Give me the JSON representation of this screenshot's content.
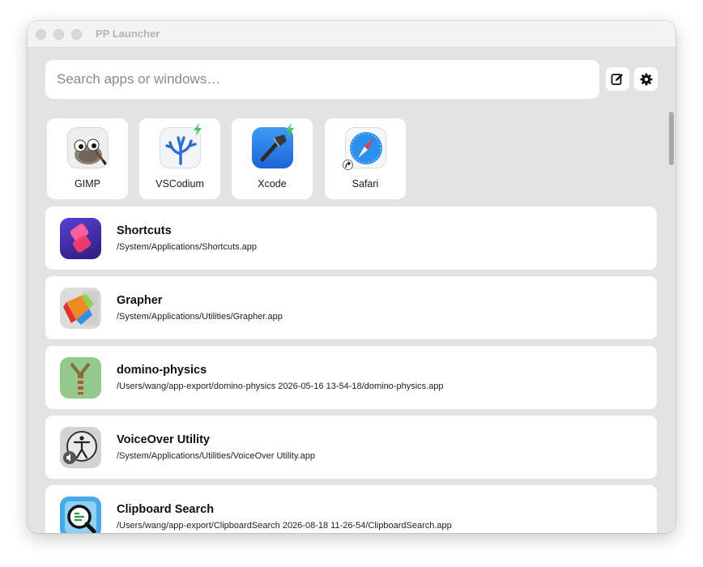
{
  "window": {
    "title": "PP Launcher"
  },
  "search": {
    "placeholder": "Search apps or windows…",
    "value": ""
  },
  "toolbar": {
    "edit_icon": "edit-icon",
    "settings_icon": "gear-icon"
  },
  "tiles": [
    {
      "label": "GIMP",
      "icon": "gimp-icon",
      "badge": ""
    },
    {
      "label": "VSCodium",
      "icon": "vscodium-icon",
      "badge": "running"
    },
    {
      "label": "Xcode",
      "icon": "xcode-icon",
      "badge": "running"
    },
    {
      "label": "Safari",
      "icon": "safari-icon",
      "badge": "alias"
    }
  ],
  "results": [
    {
      "name": "Shortcuts",
      "path": "/System/Applications/Shortcuts.app",
      "icon": "shortcuts-icon"
    },
    {
      "name": "Grapher",
      "path": "/System/Applications/Utilities/Grapher.app",
      "icon": "grapher-icon"
    },
    {
      "name": "domino-physics",
      "path": "/Users/wang/app-export/domino-physics 2026-05-16 13-54-18/domino-physics.app",
      "icon": "domino-physics-icon"
    },
    {
      "name": "VoiceOver Utility",
      "path": "/System/Applications/Utilities/VoiceOver Utility.app",
      "icon": "voiceover-utility-icon"
    },
    {
      "name": "Clipboard Search",
      "path": "/Users/wang/app-export/ClipboardSearch 2026-08-18 11-26-54/ClipboardSearch.app",
      "icon": "clipboard-search-icon"
    }
  ],
  "colors": {
    "running_badge": "#4cc75a",
    "window_bg": "#e3e3e3"
  }
}
